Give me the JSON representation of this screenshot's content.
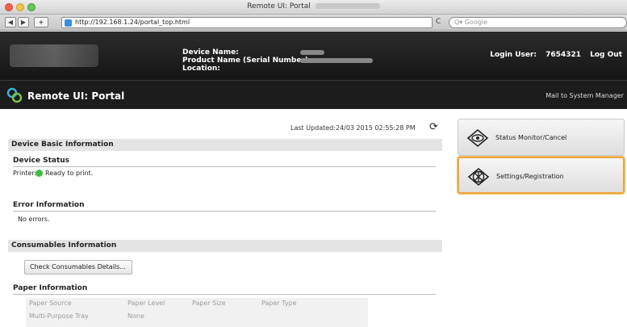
{
  "window": {
    "title": "Remote UI: Portal"
  },
  "toolbar": {
    "back": "◀",
    "forward": "▶",
    "add": "+",
    "url": "http://192.168.1.24/portal_top.html",
    "reload": "C",
    "search_placeholder": "Q▾ Google"
  },
  "device": {
    "name_label": "Device Name:",
    "product_label": "Product Name (Serial Number):",
    "location_label": "Location:",
    "login_label": "Login User:",
    "login_user": "7654321",
    "logout": "Log Out"
  },
  "portal": {
    "title": "Remote UI: Portal",
    "mail_link": "Mail to System Manager"
  },
  "main": {
    "last_updated": "Last Updated:24/03 2015 02:55:28 PM",
    "device_basic_title": "Device Basic Information",
    "device_status_title": "Device Status",
    "printer_label": "Printer:",
    "printer_status": "Ready to print.",
    "error_title": "Error Information",
    "error_text": "No errors.",
    "consumables_title": "Consumables Information",
    "check_button": "Check Consumables Details...",
    "paper_title": "Paper Information",
    "paper_headers": [
      "Paper Source",
      "Paper Level",
      "Paper Size",
      "Paper Type"
    ],
    "paper_rows": [
      [
        "Multi-Purpose Tray",
        "None",
        "",
        ""
      ]
    ]
  },
  "right_panel": {
    "status_monitor": "Status Monitor/Cancel",
    "settings": "Settings/Registration"
  },
  "colors": {
    "highlight": "#f0a43a",
    "status_green": "#3fbf3f",
    "header_bg": "#1c1c1c"
  }
}
